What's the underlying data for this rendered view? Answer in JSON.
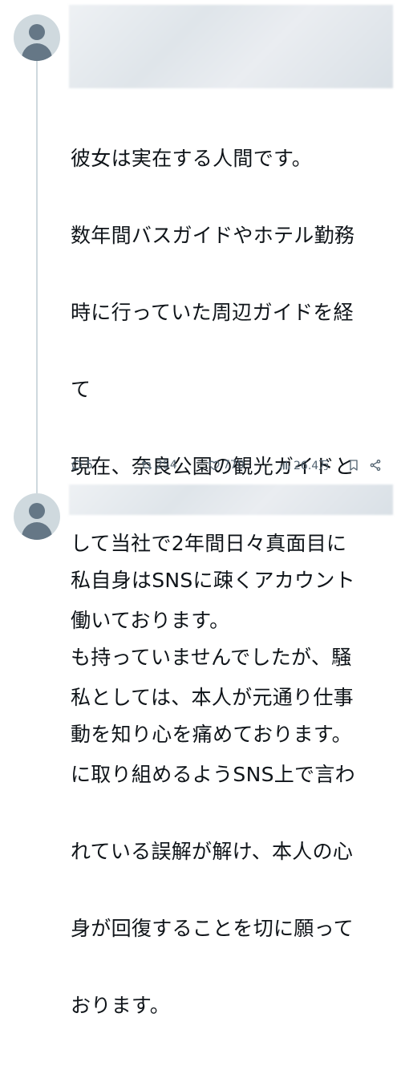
{
  "tweets": [
    {
      "text_lines": [
        "彼女は実在する人間です。",
        "数年間バスガイドやホテル勤務",
        "時に行っていた周辺ガイドを経",
        "て",
        "現在、奈良公園の観光ガイドと",
        "して当社で2年間日々真面目に",
        "働いております。",
        "私としては、本人が元通り仕事",
        "に取り組めるようSNS上で言わ",
        "れている誤解が解け、本人の心",
        "身が回復することを切に願って",
        "おります。"
      ],
      "replies": "5",
      "retweets": "254",
      "likes": "770",
      "views": "26.4万"
    },
    {
      "text_lines": [
        "私自身はSNSに疎くアカウント",
        "も持っていませんでしたが、騒",
        "動を知り心を痛めております。"
      ]
    }
  ],
  "icons": [
    "avatar-placeholder-icon",
    "reply-icon",
    "retweet-icon",
    "like-icon",
    "views-icon",
    "bookmark-icon",
    "share-icon"
  ],
  "colors": {
    "text": "#0f1419",
    "muted": "#536471",
    "thread_line": "#cfd9de"
  }
}
